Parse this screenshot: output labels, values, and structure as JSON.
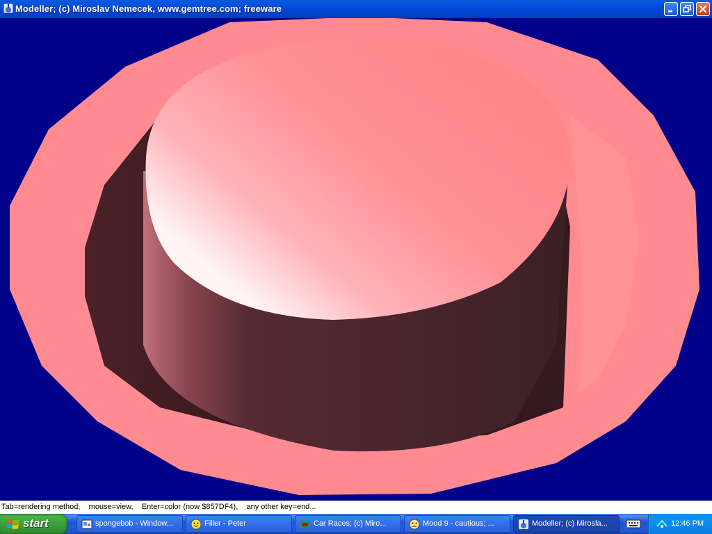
{
  "window": {
    "title": "Modeller;   (c) Miroslav Nemecek, www.gemtree.com;   freeware",
    "buttons": {
      "minimize": "minimize-icon",
      "maximize": "restore-icon",
      "close": "close-icon"
    }
  },
  "viewport": {
    "background_color": "#00008A",
    "object": "pink hat model",
    "object_color": "#FF8B8F"
  },
  "status": {
    "text": "Tab=rendering method,    mouse=view,    Enter=color (now $857DF4),    any other key=end..."
  },
  "taskbar": {
    "start_label": "start",
    "tasks": [
      {
        "label": "spongebob - Window...",
        "icon": "paint-icon",
        "active": false
      },
      {
        "label": "Filler - Peter",
        "icon": "filler-icon",
        "active": false
      },
      {
        "label": "Car Races;   (c) Miro...",
        "icon": "car-races-icon",
        "active": false
      },
      {
        "label": "Mood 9 - cautious;  ...",
        "icon": "smiley-icon",
        "active": false
      },
      {
        "label": "Modeller;   (c) Mirosla...",
        "icon": "modeller-icon",
        "active": true
      }
    ],
    "clock": "12:46 PM"
  }
}
